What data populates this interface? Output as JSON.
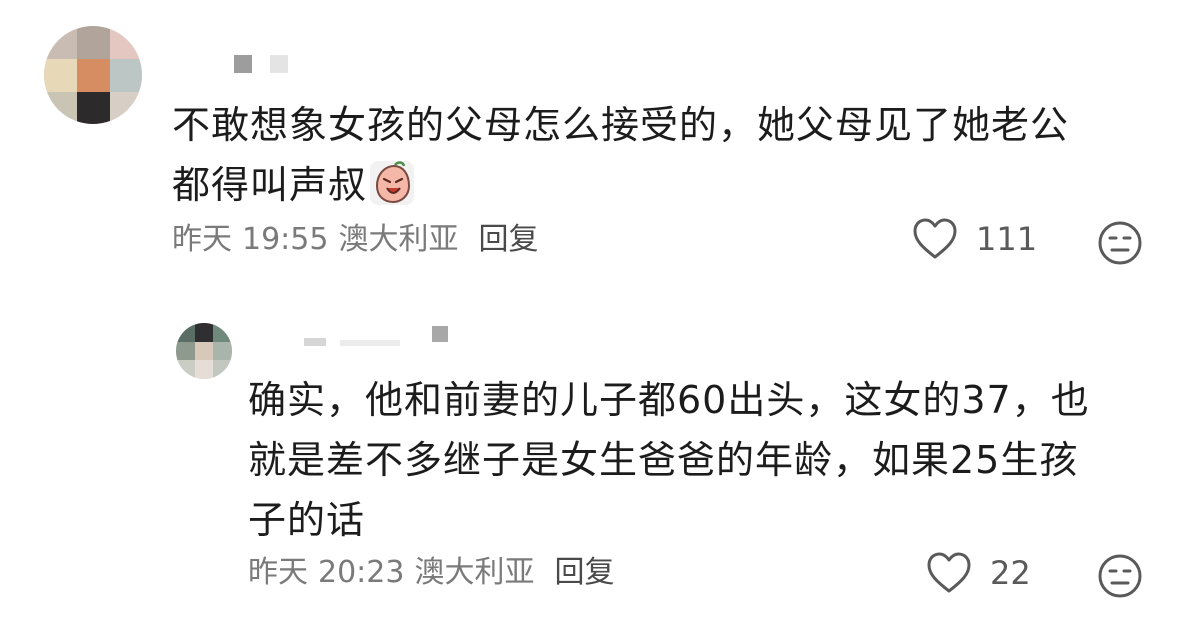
{
  "comments": [
    {
      "text_line1": "不敢想象女孩的父母怎么接受的，她父母见了她老公",
      "text_line2": "都得叫声叔",
      "emoji": "crying-face-emoji",
      "date": "昨天",
      "time": "19:55",
      "location": "澳大利亚",
      "reply_label": "回复",
      "likes": "111"
    },
    {
      "text_line1": "确实，他和前妻的儿子都60出头，这女的37，也",
      "text_line2": "就是差不多继子是女生爸爸的年龄，如果25生孩",
      "text_line3": "子的话",
      "date": "昨天",
      "time": "20:23",
      "location": "澳大利亚",
      "reply_label": "回复",
      "likes": "22"
    }
  ],
  "icons": {
    "like": "heart-outline-icon",
    "react": "neutral-face-icon"
  },
  "colors": {
    "text": "#1c1c1c",
    "meta": "#7a7a7a",
    "icon": "#5a5a5a"
  }
}
